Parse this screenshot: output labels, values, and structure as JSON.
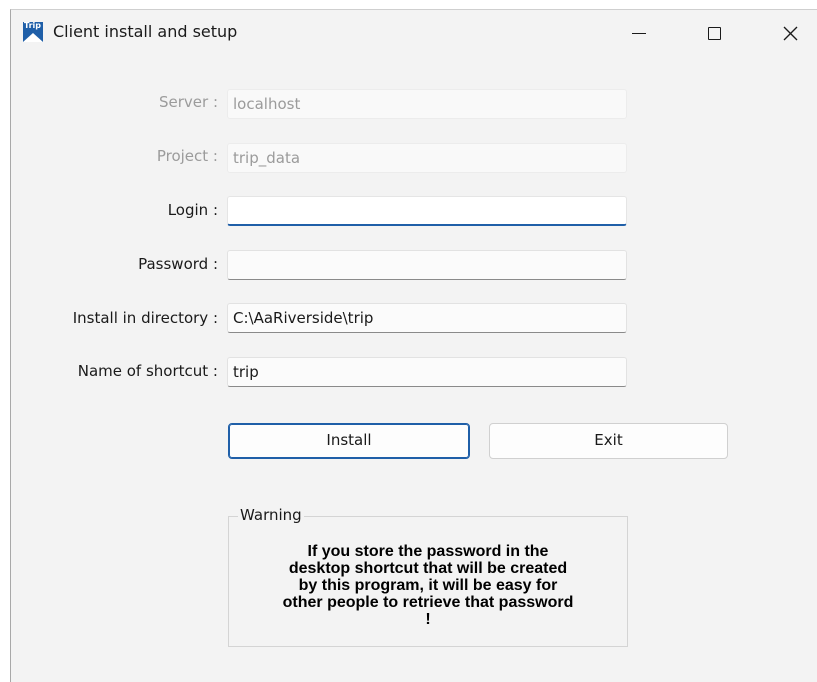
{
  "window": {
    "title": "Client install and setup",
    "app_icon_text": "Trip",
    "controls": {
      "minimize_icon": "minimize-icon",
      "maximize_icon": "maximize-icon",
      "close_icon": "close-icon"
    }
  },
  "form": {
    "server": {
      "label": "Server :",
      "value": "localhost",
      "enabled": false
    },
    "project": {
      "label": "Project :",
      "value": "trip_data",
      "enabled": false
    },
    "login": {
      "label": "Login :",
      "value": "",
      "focused": true
    },
    "password": {
      "label": "Password :",
      "value": ""
    },
    "install_dir": {
      "label": "Install in directory :",
      "value": "C:\\AaRiverside\\trip"
    },
    "shortcut": {
      "label": "Name of shortcut :",
      "value": "trip"
    }
  },
  "buttons": {
    "install": "Install",
    "exit": "Exit"
  },
  "warning": {
    "legend": "Warning",
    "line1": "If you store the password in the",
    "line2": "desktop shortcut that will be created",
    "line3": "by this program, it will be easy for",
    "line4": "other people to retrieve that password",
    "line5": "!"
  },
  "colors": {
    "accent": "#1f5fa8",
    "window_bg": "#f3f3f3",
    "disabled_text": "#9b9b9b"
  }
}
